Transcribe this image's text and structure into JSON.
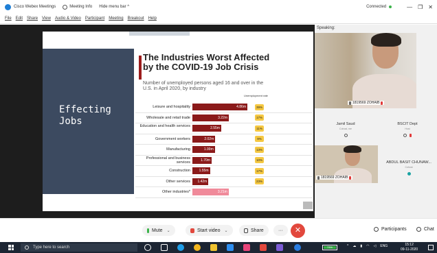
{
  "titlebar": {
    "app_name": "Cisco Webex Meetings",
    "meeting_info": "Meeting Info",
    "hide_menu": "Hide menu bar ^",
    "connection_status": "Connected",
    "connection_color": "#3bb34a",
    "minimize": "—",
    "restore": "❐",
    "close": "✕"
  },
  "menubar": {
    "items": [
      "File",
      "Edit",
      "Share",
      "View",
      "Audio & Video",
      "Participant",
      "Meeting",
      "Breakout",
      "Help"
    ]
  },
  "slide": {
    "left_text_line1": "Effecting",
    "left_text_line2": "Jobs",
    "title": "The Industries Worst Affected by the COVID-19 Job Crisis",
    "subtitle": "Number of unemployed persons aged 16 and over in the U.S. in April 2020, by industry",
    "ur_header": "Unemployment rate",
    "bars": [
      {
        "label": "Leisure and hospitality",
        "value_label": "4.86m",
        "value": 4.86,
        "rate": "39%",
        "highlight": false
      },
      {
        "label": "Wholesale and retail trade",
        "value_label": "3.22m",
        "value": 3.22,
        "rate": "17%",
        "highlight": false
      },
      {
        "label": "Education and health services",
        "value_label": "2.55m",
        "value": 2.55,
        "rate": "11%",
        "highlight": false
      },
      {
        "label": "Government workers",
        "value_label": "2.02m",
        "value": 2.02,
        "rate": "9%",
        "highlight": false
      },
      {
        "label": "Manufacturing",
        "value_label": "1.99m",
        "value": 1.99,
        "rate": "13%",
        "highlight": false
      },
      {
        "label": "Professional and business services",
        "value_label": "1.70m",
        "value": 1.7,
        "rate": "10%",
        "highlight": false
      },
      {
        "label": "Construction",
        "value_label": "1.55m",
        "value": 1.55,
        "rate": "17%",
        "highlight": false
      },
      {
        "label": "Other services",
        "value_label": "1.42m",
        "value": 1.42,
        "rate": "23%",
        "highlight": false
      },
      {
        "label": "Other industries*",
        "value_label": "3.21m",
        "value": 3.21,
        "rate": "",
        "highlight": true
      }
    ],
    "bar_color": "#8b1a1a",
    "highlight_color": "#f08a9a",
    "badge_color": "#f5c842"
  },
  "side": {
    "speaking_label": "Speaking:",
    "main_video_name": "1819569 ZOHAIB",
    "tiles": [
      {
        "name": "Jamil Saud",
        "sub": "Cohost, me"
      },
      {
        "name": "BSCIT Dept",
        "sub": "Host"
      },
      {
        "name": "ABDUL BASIT CHUNAW...",
        "sub": "Cohost"
      }
    ],
    "small_video_name": "1819569 ZOHAIB"
  },
  "controls": {
    "mute": "Mute",
    "start_video": "Start video",
    "share": "Share",
    "more": "···",
    "end": "✕",
    "participants": "Participants",
    "chat": "Chat"
  },
  "taskbar": {
    "search_placeholder": "Type here to search",
    "battery": "73%",
    "language": "ENG",
    "time": "15:12",
    "date": "09-11-2020"
  }
}
